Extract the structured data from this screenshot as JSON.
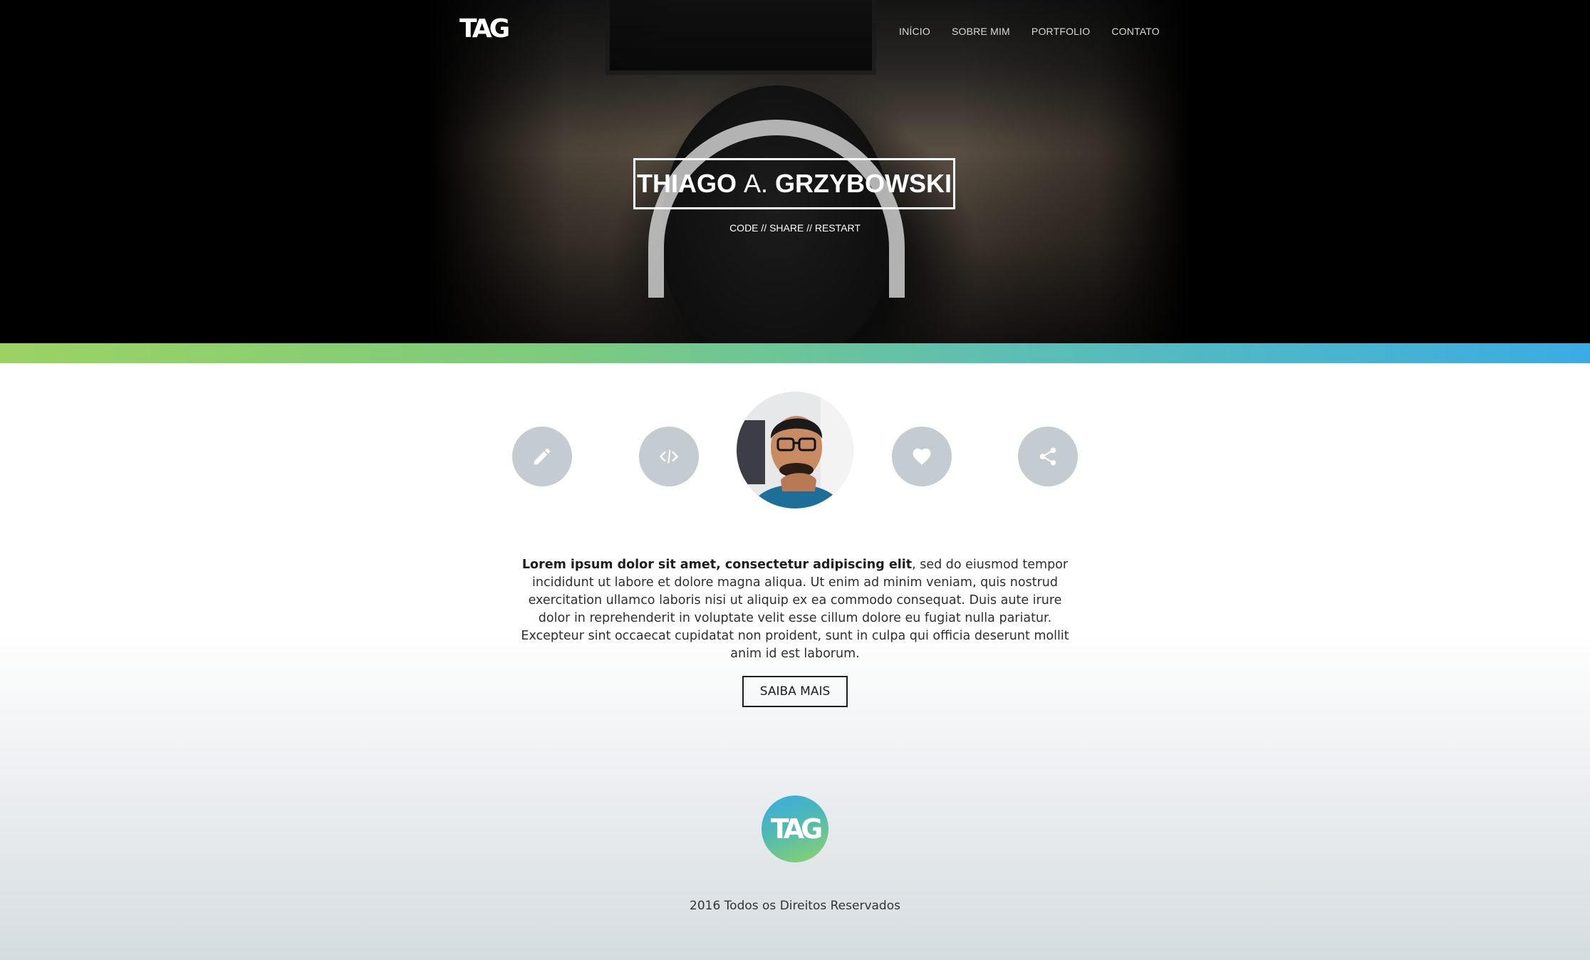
{
  "header": {
    "logo_text": "TAG",
    "nav": [
      {
        "label": "INÍCIO"
      },
      {
        "label": "SOBRE MIM"
      },
      {
        "label": "PORTFOLIO"
      },
      {
        "label": "CONTATO"
      }
    ]
  },
  "hero": {
    "title_first": "THIAGO",
    "title_middle": "A.",
    "title_last": "GRZYBOWSKI",
    "tagline": "CODE // SHARE // RESTART"
  },
  "colors": {
    "strip_gradient": [
      "#9bd362",
      "#3aace4"
    ],
    "icon_circle": "#c4ccd1"
  },
  "features": {
    "icons": [
      "pencil-icon",
      "code-icon",
      "heart-icon",
      "share-icon"
    ]
  },
  "intro": {
    "bold_lead": "Lorem ipsum dolor sit amet, consectetur adipiscing elit",
    "body": ", sed do eiusmod tempor incididunt ut labore et dolore magna aliqua. Ut enim ad minim veniam, quis nostrud exercitation ullamco laboris nisi ut aliquip ex ea commodo consequat. Duis aute irure dolor in reprehenderit in voluptate velit esse cillum dolore eu fugiat nulla pariatur. Excepteur sint occaecat cupidatat non proident, sunt in culpa qui officia deserunt mollit anim id est laborum.",
    "button_label": "SAIBA MAIS"
  },
  "footer": {
    "logo_text": "TAG",
    "copyright": "2016 Todos os Direitos Reservados"
  }
}
